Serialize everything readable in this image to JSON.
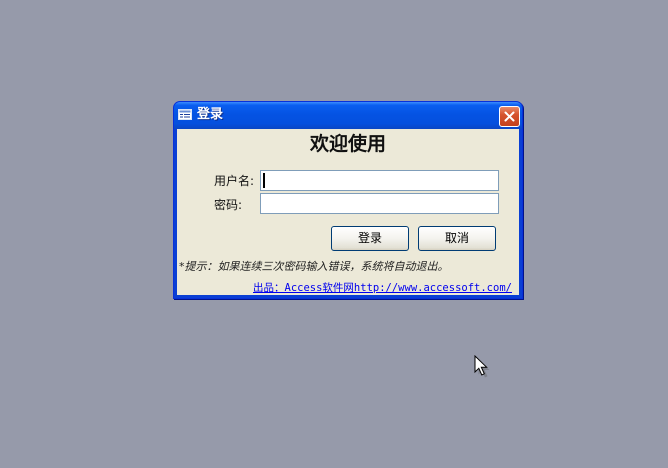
{
  "window": {
    "title": "登录",
    "icon": "form-window-icon",
    "close_icon": "close-icon"
  },
  "dialog": {
    "heading": "欢迎使用",
    "username_label": "用户名:",
    "username_value": "",
    "password_label": "密码:",
    "password_value": "",
    "login_button": "登录",
    "cancel_button": "取消",
    "hint": "*提示：如果连续三次密码输入错误，系统将自动退出。",
    "credits": "出品：Access软件网http://www.accessoft.com/"
  },
  "colors": {
    "desktop": "#969aaa",
    "titlebar": "#0553e3",
    "client": "#ece9d8",
    "close_button": "#d6532e",
    "link": "#0000ee"
  },
  "cursor": {
    "icon": "arrow-pointer-icon"
  }
}
